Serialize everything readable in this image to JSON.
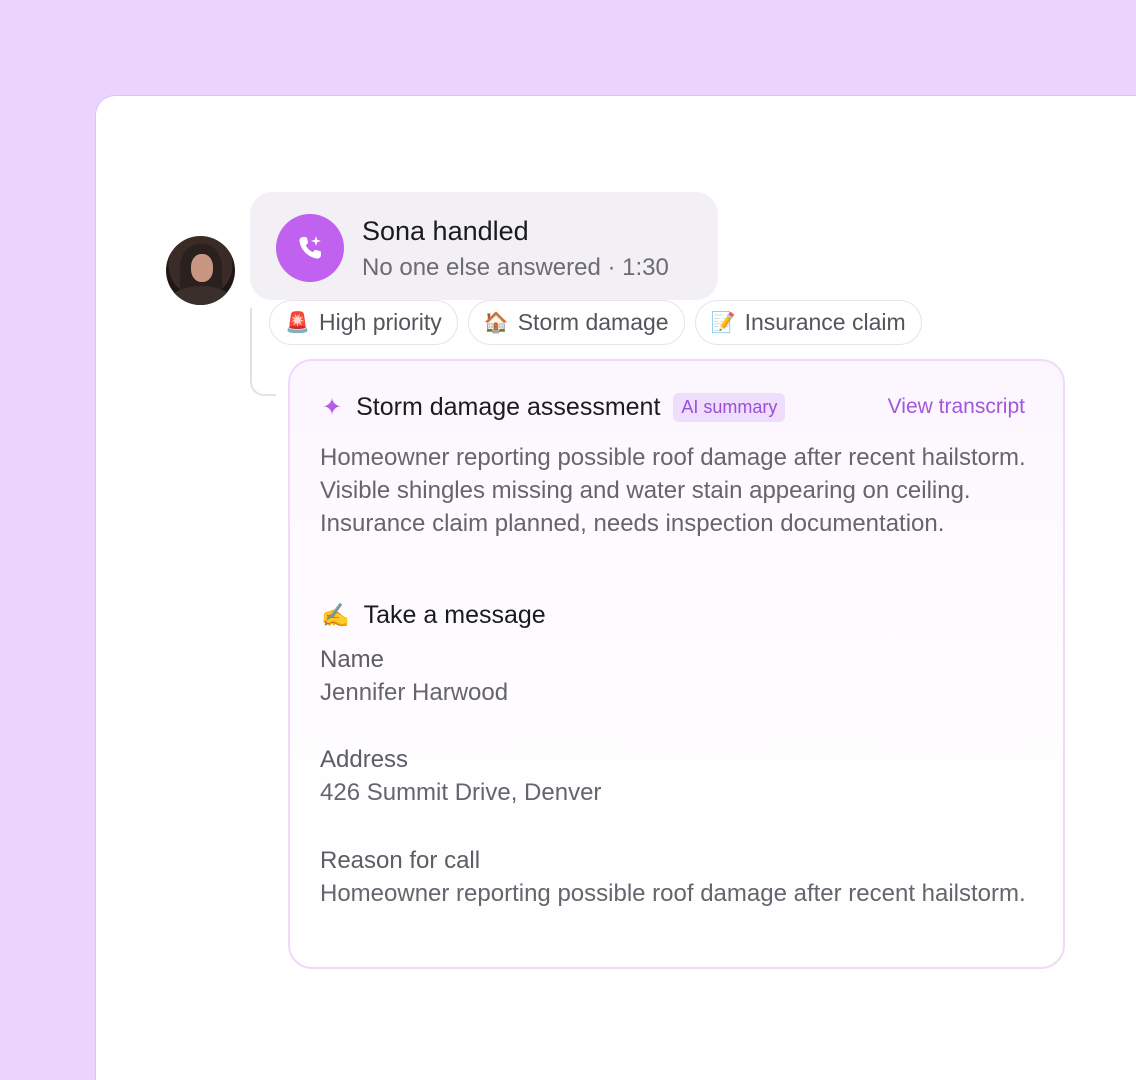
{
  "call": {
    "title": "Sona handled",
    "subtitle": "No one else answered · 1:30",
    "icon": "phone-sparkle-icon"
  },
  "tags": [
    {
      "emoji": "🚨",
      "label": "High priority"
    },
    {
      "emoji": "🏠",
      "label": "Storm damage"
    },
    {
      "emoji": "📝",
      "label": "Insurance claim"
    }
  ],
  "summary": {
    "title": "Storm damage assessment",
    "badge": "AI summary",
    "link": "View transcript",
    "body": "Homeowner reporting possible roof damage after recent hailstorm. Visible shingles missing and water stain appearing on ceiling. Insurance claim planned, needs inspection documentation."
  },
  "message": {
    "emoji": "✍️",
    "title": "Take a message",
    "fields": [
      {
        "label": "Name",
        "value": "Jennifer Harwood"
      },
      {
        "label": "Address",
        "value": "426 Summit Drive, Denver"
      },
      {
        "label": "Reason for call",
        "value": "Homeowner reporting possible roof damage after recent hailstorm."
      }
    ]
  },
  "colors": {
    "background": "#ecd3fe",
    "accent": "#c161f0",
    "link": "#a257dc",
    "badge_bg": "#eeddfc"
  }
}
